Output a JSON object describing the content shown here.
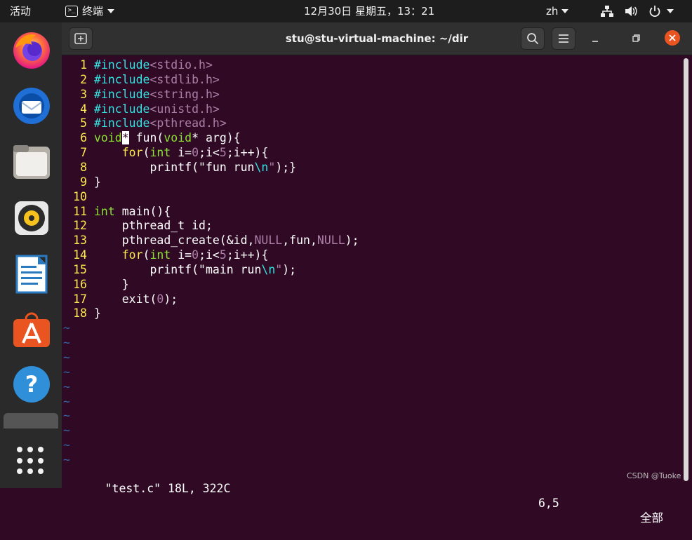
{
  "topbar": {
    "activities": "活动",
    "app_name": "终端",
    "clock": "12月30日 星期五，13：21",
    "language": "zh"
  },
  "dock": {
    "items": [
      {
        "name": "firefox"
      },
      {
        "name": "thunderbird"
      },
      {
        "name": "files"
      },
      {
        "name": "rhythmbox"
      },
      {
        "name": "libreoffice-writer"
      },
      {
        "name": "ubuntu-software"
      },
      {
        "name": "help"
      }
    ]
  },
  "window": {
    "title": "stu@stu-virtual-machine: ~/dir"
  },
  "editor": {
    "lines": [
      {
        "n": "1",
        "tokens": [
          [
            "#include",
            "pre"
          ],
          [
            "<stdio.h>",
            "str"
          ]
        ]
      },
      {
        "n": "2",
        "tokens": [
          [
            "#include",
            "pre"
          ],
          [
            "<stdlib.h>",
            "str"
          ]
        ]
      },
      {
        "n": "3",
        "tokens": [
          [
            "#include",
            "pre"
          ],
          [
            "<string.h>",
            "str"
          ]
        ]
      },
      {
        "n": "4",
        "tokens": [
          [
            "#include",
            "pre"
          ],
          [
            "<unistd.h>",
            "str"
          ]
        ]
      },
      {
        "n": "5",
        "tokens": [
          [
            "#include",
            "pre"
          ],
          [
            "<pthread.h>",
            "str"
          ]
        ]
      },
      {
        "n": "6",
        "tokens": [
          [
            "void",
            "type"
          ],
          [
            "*",
            "cursor"
          ],
          [
            " fun(",
            ""
          ],
          [
            "void",
            "type"
          ],
          [
            "* arg){",
            ""
          ]
        ]
      },
      {
        "n": "7",
        "tokens": [
          [
            "    ",
            ""
          ],
          [
            "for",
            "kw"
          ],
          [
            "(",
            ""
          ],
          [
            "int",
            "type"
          ],
          [
            " i=",
            ""
          ],
          [
            "0",
            "num"
          ],
          [
            ";i<",
            ""
          ],
          [
            "5",
            "num"
          ],
          [
            ";i++){",
            ""
          ]
        ]
      },
      {
        "n": "8",
        "tokens": [
          [
            "        printf(",
            ""
          ],
          [
            "\"fun run",
            ""
          ],
          [
            "\\n",
            "pre"
          ],
          [
            "\"",
            "str"
          ],
          [
            ");}",
            ""
          ]
        ]
      },
      {
        "n": "9",
        "tokens": [
          [
            "}",
            ""
          ]
        ]
      },
      {
        "n": "10",
        "tokens": []
      },
      {
        "n": "11",
        "tokens": [
          [
            "int",
            "type"
          ],
          [
            " main(){",
            ""
          ]
        ]
      },
      {
        "n": "12",
        "tokens": [
          [
            "    pthread_t id;",
            ""
          ]
        ]
      },
      {
        "n": "13",
        "tokens": [
          [
            "    pthread_create(&id,",
            ""
          ],
          [
            "NULL",
            "num"
          ],
          [
            ",fun,",
            ""
          ],
          [
            "NULL",
            "num"
          ],
          [
            ");",
            ""
          ]
        ]
      },
      {
        "n": "14",
        "tokens": [
          [
            "    ",
            ""
          ],
          [
            "for",
            "kw"
          ],
          [
            "(",
            ""
          ],
          [
            "int",
            "type"
          ],
          [
            " i=",
            ""
          ],
          [
            "0",
            "num"
          ],
          [
            ";i<",
            ""
          ],
          [
            "5",
            "num"
          ],
          [
            ";i++){",
            ""
          ]
        ]
      },
      {
        "n": "15",
        "tokens": [
          [
            "        printf(",
            ""
          ],
          [
            "\"main run",
            ""
          ],
          [
            "\\n",
            "pre"
          ],
          [
            "\"",
            "str"
          ],
          [
            ");",
            ""
          ]
        ]
      },
      {
        "n": "16",
        "tokens": [
          [
            "    }",
            ""
          ]
        ]
      },
      {
        "n": "17",
        "tokens": [
          [
            "    exit(",
            ""
          ],
          [
            "0",
            "num"
          ],
          [
            ");",
            ""
          ]
        ]
      },
      {
        "n": "18",
        "tokens": [
          [
            "}",
            ""
          ]
        ]
      }
    ],
    "tilde_count": 10,
    "tilde_char": "~",
    "status_file": "\"test.c\" 18L, 322C",
    "status_position": "6,5",
    "status_percent": "全部"
  },
  "watermark": "CSDN @Tuoke"
}
